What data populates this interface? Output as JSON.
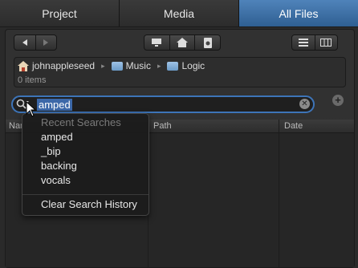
{
  "tabs": [
    {
      "label": "Project",
      "active": false
    },
    {
      "label": "Media",
      "active": false
    },
    {
      "label": "All Files",
      "active": true
    }
  ],
  "toolbar": {
    "back_icon": "back-arrow-icon",
    "forward_icon": "forward-arrow-icon",
    "computer_icon": "computer-icon",
    "home_icon": "home-icon",
    "document_icon": "document-icon",
    "list_view_icon": "list-view-icon",
    "column_view_icon": "column-view-icon"
  },
  "breadcrumb": {
    "items": [
      "johnappleseed",
      "Music",
      "Logic"
    ],
    "status": "0 items"
  },
  "search": {
    "value": "amped"
  },
  "table": {
    "columns": [
      "Nar",
      "Path",
      "Date"
    ]
  },
  "recent_searches": {
    "header": "Recent Searches",
    "items": [
      "amped",
      "_bip",
      "backing",
      "vocals"
    ],
    "clear_label": "Clear Search History"
  },
  "colors": {
    "accent": "#3d74b8",
    "tab_active": "#3f72a8"
  }
}
